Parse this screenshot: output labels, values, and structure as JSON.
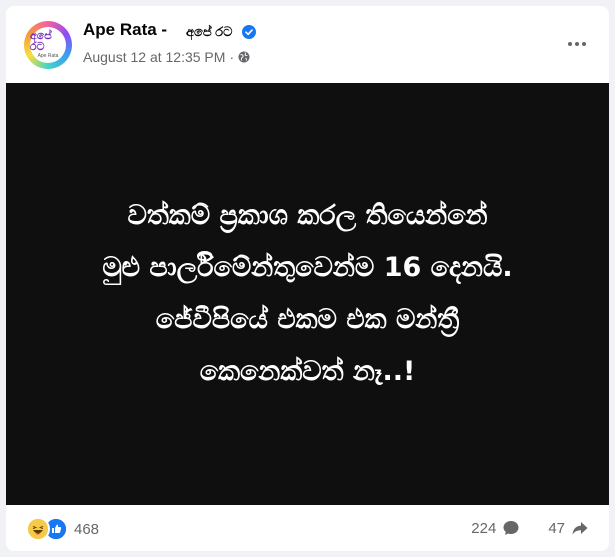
{
  "post": {
    "author": "Ape Rata -",
    "author_local": "අපේ රට",
    "avatar_text": "අපේ රට",
    "avatar_sub": "Ape Rata",
    "timestamp": "August 12 at 12:35 PM",
    "separator": "·",
    "image_lines": [
      "වත්කම් ප්‍රකාශ කරල තියෙන්නේ",
      "මුළු පාර්ලිමේන්තුවෙන්ම 16 දෙනයි.",
      "ජේවීපියේ එකම එක මන්ත්‍රී",
      "කෙනෙක්වත් නෑ..!"
    ]
  },
  "stats": {
    "reactions": "468",
    "comments": "224",
    "shares": "47"
  },
  "icons": {
    "verified": "verified-badge-icon",
    "audience": "globe-icon",
    "more": "more-options-icon",
    "haha": "haha-reaction-icon",
    "like": "like-reaction-icon",
    "comment": "comment-icon",
    "share": "share-icon"
  },
  "colors": {
    "brand_blue": "#1877f2",
    "secondary_text": "#65676b",
    "image_bg": "#0f0f0f"
  }
}
